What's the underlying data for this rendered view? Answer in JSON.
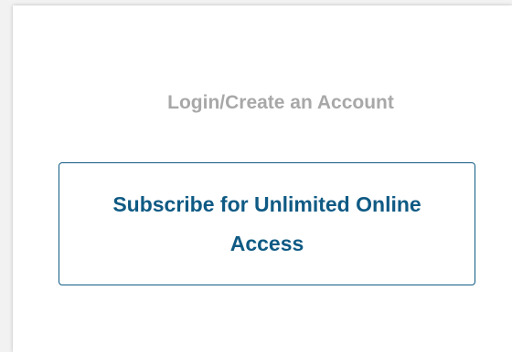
{
  "auth": {
    "login_label": "Login/Create an Account"
  },
  "subscribe": {
    "label": "Subscribe for Unlimited Online Access"
  },
  "colors": {
    "link_gray": "#a8a8a8",
    "brand_blue": "#0f5a84",
    "panel_bg": "#ffffff",
    "page_bg": "#f2f2f2"
  }
}
